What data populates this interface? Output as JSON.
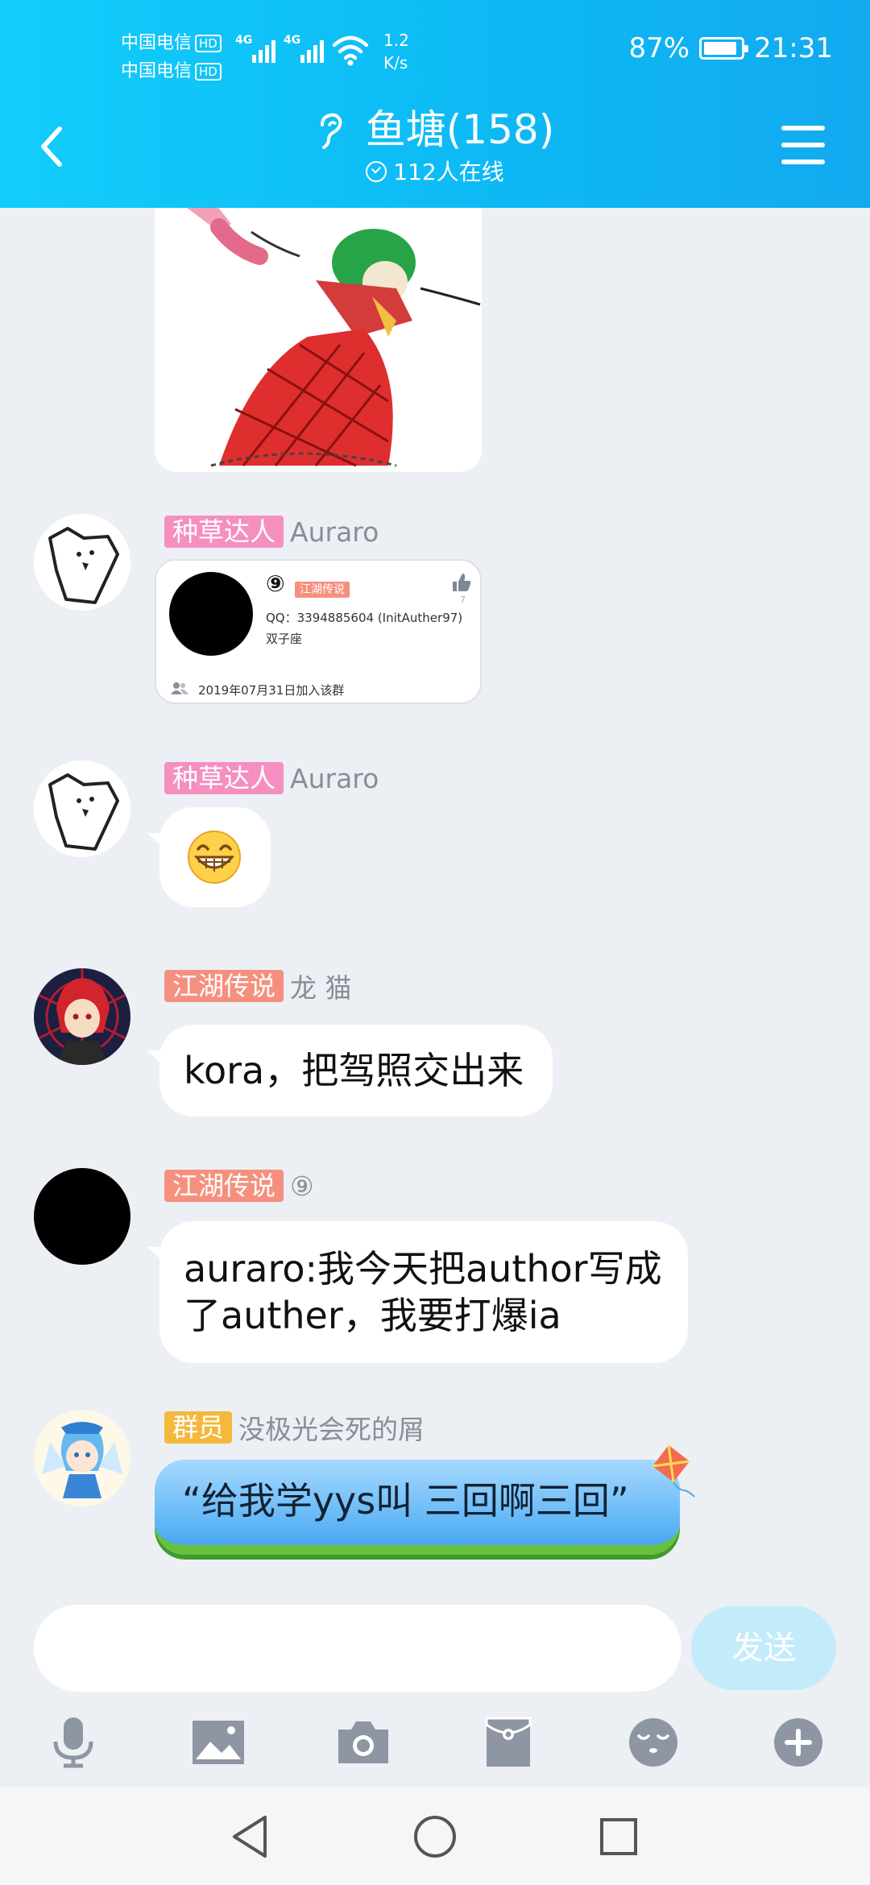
{
  "status_bar": {
    "carrier_1": "中国电信",
    "carrier_2": "中国电信",
    "hd": "HD",
    "net_1": "4G",
    "net_2": "4G",
    "speed_value": "1.2",
    "speed_unit": "K/s",
    "battery": "87%",
    "time": "21:31"
  },
  "header": {
    "title": "鱼塘(158)",
    "online": "112人在线"
  },
  "messages": [
    {
      "type": "card",
      "badge": "种草达人",
      "nick": "Auraro",
      "card": {
        "num": "⑨",
        "tag": "江湖传说",
        "thumb_count": "7",
        "qq": "QQ：3394885604 (InitAuther97)",
        "zodiac": "双子座",
        "joined": "2019年07月31日加入该群"
      }
    },
    {
      "type": "emoji",
      "badge": "种草达人",
      "nick": "Auraro"
    },
    {
      "type": "text",
      "badge": "江湖传说",
      "nick": "龙 猫",
      "text": "kora，把驾照交出来"
    },
    {
      "type": "text",
      "badge": "江湖传说",
      "nick": "⑨",
      "text_line1": "auraro:我今天把author写成",
      "text_line2": "了auther，我要打爆ia"
    },
    {
      "type": "fancy",
      "badge": "群员",
      "nick": "没极光会死的屑",
      "text": "“给我学yys叫 三回啊三回”"
    }
  ],
  "input": {
    "placeholder": "",
    "send_label": "发送"
  },
  "colors": {
    "header_start": "#12cdfb",
    "header_end": "#13a9f0",
    "badge_pink": "#f58fc0",
    "badge_salmon": "#f6907e",
    "badge_yellow": "#f4b83b",
    "send_button": "#c3ecfb",
    "chat_background": "#eceff4"
  },
  "icons": {
    "toolbar": [
      "microphone-icon",
      "image-icon",
      "camera-icon",
      "red-packet-icon",
      "emoji-icon",
      "plus-icon"
    ],
    "navbar": [
      "nav-back-icon",
      "nav-home-icon",
      "nav-recent-icon"
    ]
  }
}
